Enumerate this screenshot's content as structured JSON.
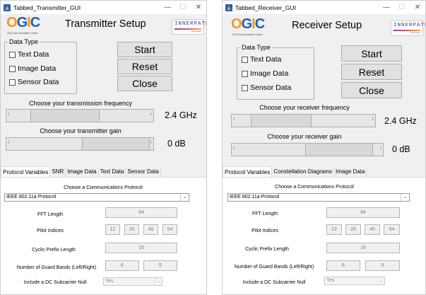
{
  "left": {
    "window_title": "Tabbed_Transmitter_GUI",
    "heading": "Transmitter Setup",
    "data_type": {
      "legend": "Data Type",
      "options": [
        "Text Data",
        "Image Data",
        "Sensor Data"
      ]
    },
    "buttons": {
      "start": "Start",
      "reset": "Reset",
      "close": "Close"
    },
    "freq_label": "Choose your transmission frequency",
    "freq_value": "2.4 GHz",
    "gain_label": "Choose your transmitter gain",
    "gain_value": "0 dB",
    "tabs": [
      "Protocol Variables",
      "SNR",
      "Image Data",
      "Text Data",
      "Sensor Data"
    ]
  },
  "right": {
    "window_title": "Tabbed_Receiver_GUI",
    "heading": "Receiver Setup",
    "data_type": {
      "legend": "Data Type",
      "options": [
        "Text Data",
        "Image Data",
        "Sensor Data"
      ]
    },
    "buttons": {
      "start": "Start",
      "reset": "Reset",
      "close": "Close"
    },
    "freq_label": "Choose your receiver frequency",
    "freq_value": "2.4 GHz",
    "gain_label": "Choose your receiver gain",
    "gain_value": "0 dB",
    "tabs": [
      "Protocol Variables",
      "Constellation Diagrams",
      "Image Data"
    ]
  },
  "logo": {
    "text": "OGIC",
    "sub": "Oil & Gas Innovation Centre"
  },
  "partner_logo": {
    "text": "INNERPATH",
    "sub": "Technologies"
  },
  "titlebar": {
    "minimize": "—",
    "maximize": "☐",
    "close": "✕"
  },
  "slider_arrows": {
    "left": "‹",
    "right": "›"
  },
  "protocol": {
    "choose_label": "Choose a Communications Protocol",
    "protocol_value": "IEEE 802.11a Protocol",
    "fft_label": "FFT Length",
    "fft_value": "64",
    "pilot_label": "Pilot Indices",
    "pilot_values": [
      "12",
      "26",
      "40",
      "54"
    ],
    "cp_label": "Cyclic Prefix Length",
    "cp_value": "16",
    "guard_label": "Number of Guard Bands (Left/Right)",
    "guard_values": [
      "6",
      "5"
    ],
    "dc_label": "Include a DC Subcarrier Null",
    "dc_value": "Yes"
  },
  "icons": {
    "window": "matlab-figure-icon",
    "dropdown": "chevron-down-icon"
  },
  "colors": {
    "window_bg": "#f0f0f0",
    "panel_bg": "#ffffff",
    "logo_orange": "#f29a1a",
    "logo_blue": "#1f5fb0"
  }
}
